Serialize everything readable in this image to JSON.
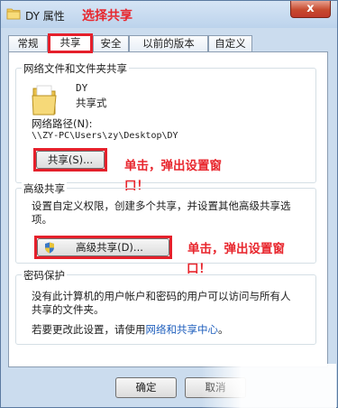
{
  "window": {
    "title": "DY 属性",
    "annotation": "选择共享",
    "close_label": "x"
  },
  "tabs": [
    {
      "label": "常规",
      "active": false
    },
    {
      "label": "共享",
      "active": true
    },
    {
      "label": "安全",
      "active": false
    },
    {
      "label": "以前的版本",
      "active": false
    },
    {
      "label": "自定义",
      "active": false
    }
  ],
  "network_share": {
    "group_title": "网络文件和文件夹共享",
    "folder_name": "DY",
    "share_status": "共享式",
    "path_label": "网络路径(N):",
    "path_value": "\\\\ZY-PC\\Users\\zy\\Desktop\\DY",
    "share_button": "共享(S)...",
    "annotation_line1": "单击，弹出设置窗",
    "annotation_line2": "口！"
  },
  "advanced_share": {
    "group_title": "高级共享",
    "description_line1": "设置自定义权限，创建多个共享，并设置其他高级共享选",
    "description_line2": "项。",
    "button_label": "高级共享(D)...",
    "annotation_line1": "单击，弹出设置窗",
    "annotation_line2": "口！"
  },
  "password": {
    "group_title": "密码保护",
    "line1": "没有此计算机的用户帐户和密码的用户可以访问与所有人",
    "line2": "共享的文件夹。",
    "change_prefix": "若要更改此设置，请使用",
    "change_link": "网络和共享中心",
    "change_suffix": "。"
  },
  "footer": {
    "ok_label": "确定",
    "cancel_label": "取消"
  },
  "colors": {
    "highlight": "#e5202b",
    "annotation": "#e8262d",
    "link": "#1f5fbd"
  }
}
